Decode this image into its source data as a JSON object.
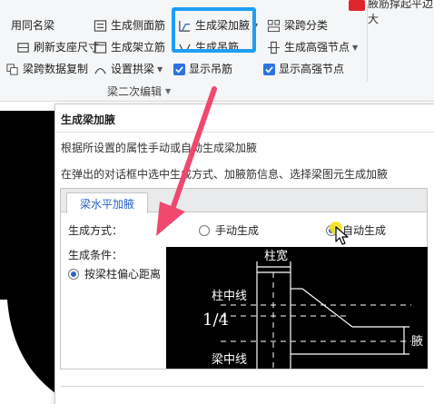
{
  "ribbon": {
    "r1": {
      "apply_same_name": "用同名梁",
      "gen_side_rebar": "生成侧面筋",
      "gen_haunch": "生成梁加腋",
      "span_class": "梁跨分类",
      "top_right": "腋筋撑起平边大"
    },
    "r2": {
      "refresh_support": "刷新支座尺寸",
      "gen_stirrup_tie": "生成架立筋",
      "gen_hanger": "生成吊筋",
      "gen_high_node": "生成高强节点"
    },
    "r3": {
      "copy_span_data": "梁跨数据复制",
      "set_arch": "设置拱梁",
      "show_hanger": "显示吊筋",
      "show_high_node": "显示高强节点"
    },
    "group_label": "梁二次编辑"
  },
  "tooltip": {
    "title": "生成梁加腋",
    "desc1": "根据所设置的属性手动或自动生成梁加腋",
    "desc2": "在弹出的对话框中选中生成方式、加腋筋信息、选择梁图元生成加腋",
    "dialog": {
      "tab": "梁水平加腋",
      "method_label": "生成方式：",
      "method_manual": "手动生成",
      "method_auto": "自动生成",
      "method_selected": "auto",
      "condition_label": "生成条件：",
      "condition_option": "按梁柱偏心距离",
      "diagram": {
        "column_width": "柱宽",
        "column_centerline": "柱中线",
        "quarter": "1/4",
        "beam_centerline": "梁中线",
        "side_label": "腋"
      }
    }
  },
  "colors": {
    "accent_blue": "#1e9ff2",
    "checkbox_blue": "#2f73e0",
    "arrow_pink": "#f0486e",
    "badge_red": "#e0262c",
    "cursor_yellow": "#f4e21c"
  },
  "icons": [
    "apply-same-name-icon",
    "side-rebar-icon",
    "haunch-icon",
    "span-class-icon",
    "refresh-support-icon",
    "stirrup-tie-icon",
    "hanger-icon",
    "high-node-icon",
    "copy-span-icon",
    "arch-icon",
    "check-icon",
    "mouse-cursor-icon",
    "pointer-arrow"
  ]
}
